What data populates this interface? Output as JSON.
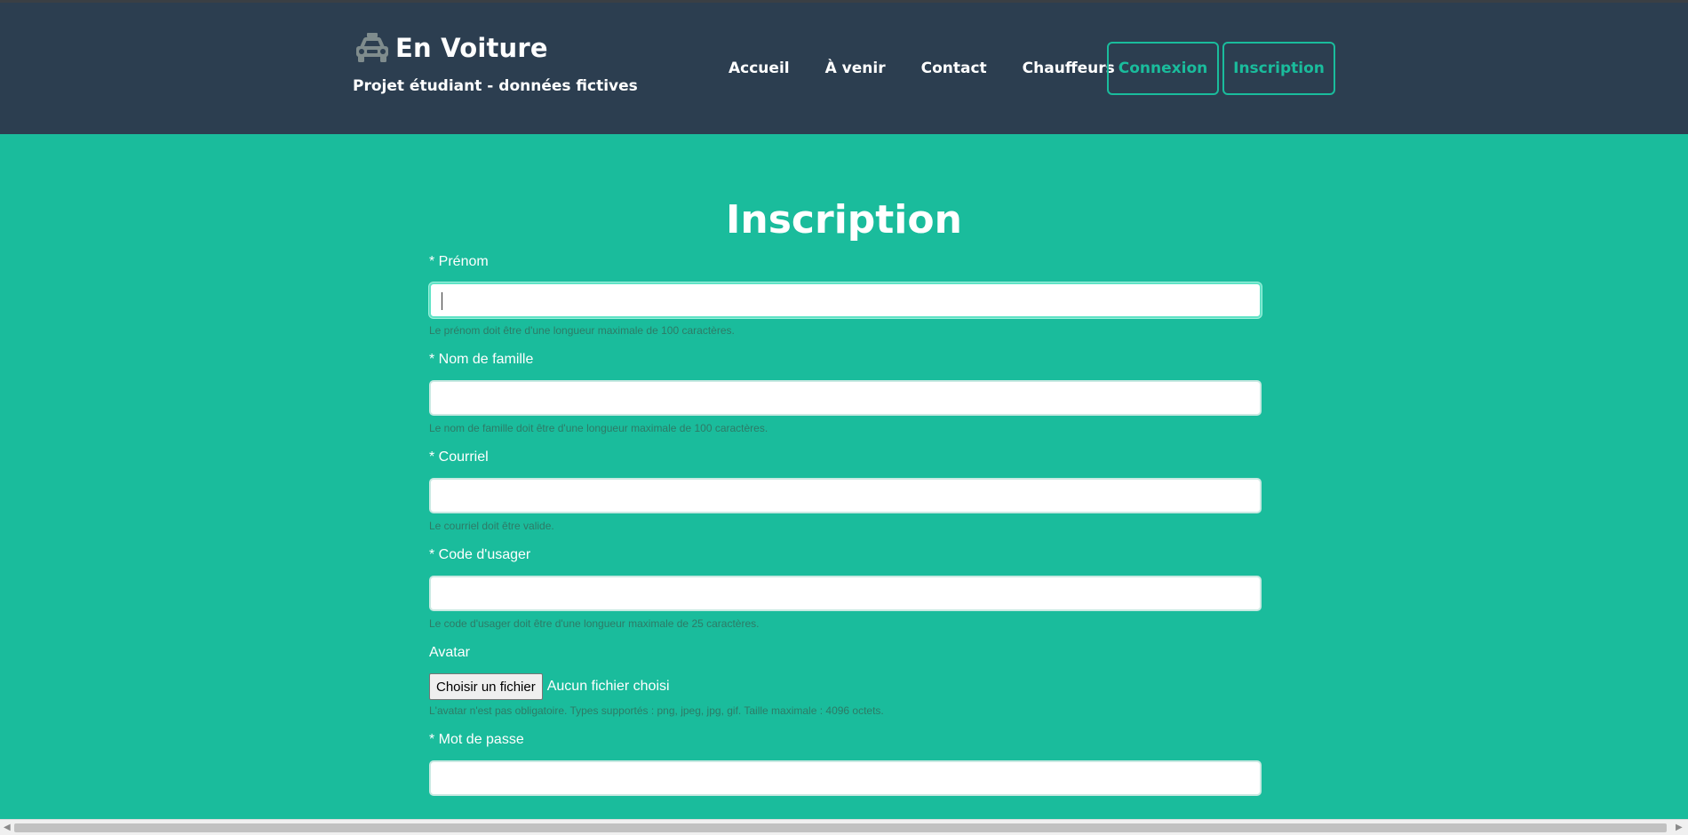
{
  "brand": {
    "title": "En Voiture",
    "subtitle": "Projet étudiant - données fictives",
    "icon": "taxi-icon"
  },
  "nav": {
    "links": [
      "Accueil",
      "À venir",
      "Contact",
      "Chauffeurs"
    ],
    "login": "Connexion",
    "signup": "Inscription"
  },
  "page": {
    "title": "Inscription"
  },
  "form": {
    "prenom": {
      "label": "* Prénom",
      "value": "",
      "help": "Le prénom doit être d'une longueur maximale de 100 caractères."
    },
    "nom": {
      "label": "* Nom de famille",
      "value": "",
      "help": "Le nom de famille doit être d'une longueur maximale de 100 caractères."
    },
    "courriel": {
      "label": "* Courriel",
      "value": "",
      "help": "Le courriel doit être valide."
    },
    "code": {
      "label": "* Code d'usager",
      "value": "",
      "help": "Le code d'usager doit être d'une longueur maximale de 25 caractères."
    },
    "avatar": {
      "label": "Avatar",
      "button": "Choisir un fichier",
      "status": "Aucun fichier choisi",
      "help": "L'avatar n'est pas obligatoire. Types supportés : png, jpeg, jpg, gif. Taille maximale : 4096 octets."
    },
    "password": {
      "label": "* Mot de passe",
      "value": ""
    }
  },
  "colors": {
    "header_bg": "#2c3e50",
    "page_bg": "#1abc9c",
    "accent": "#1abc9c"
  }
}
